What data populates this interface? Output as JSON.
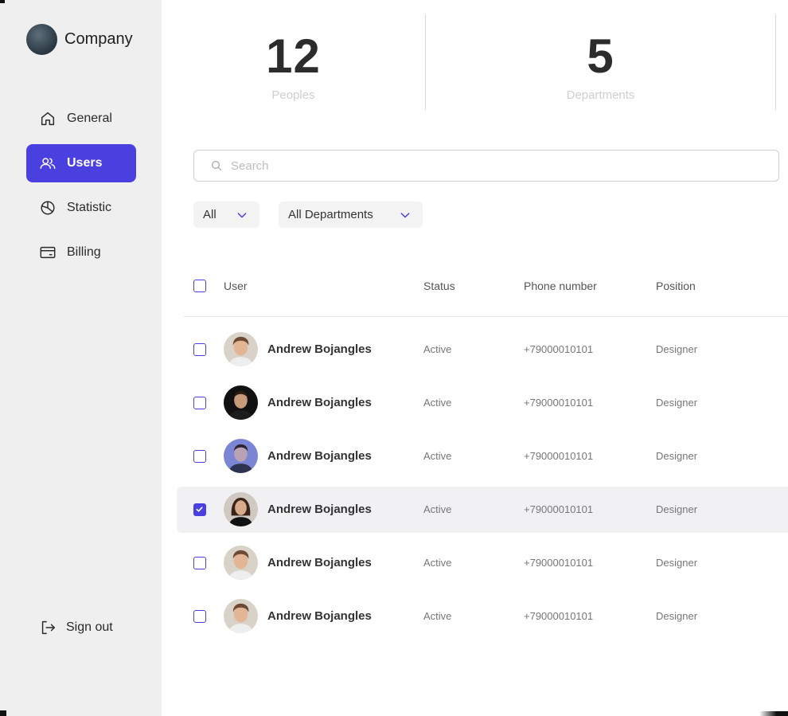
{
  "brand": {
    "name": "Company"
  },
  "nav": [
    {
      "label": "General",
      "icon": "home-icon",
      "active": false
    },
    {
      "label": "Users",
      "icon": "users-icon",
      "active": true
    },
    {
      "label": "Statistic",
      "icon": "pie-chart-icon",
      "active": false
    },
    {
      "label": "Billing",
      "icon": "credit-card-icon",
      "active": false
    }
  ],
  "signout": {
    "label": "Sign out",
    "icon": "sign-out-icon"
  },
  "stats": [
    {
      "value": "12",
      "label": "Peoples"
    },
    {
      "value": "5",
      "label": "Departments"
    }
  ],
  "search": {
    "placeholder": "Search",
    "value": ""
  },
  "filters": {
    "status": "All",
    "department": "All Departments"
  },
  "table": {
    "headers": {
      "user": "User",
      "status": "Status",
      "phone": "Phone number",
      "position": "Position"
    },
    "rows": [
      {
        "name": "Andrew Bojangles",
        "status": "Active",
        "phone": "+79000010101",
        "position": "Designer",
        "checked": false
      },
      {
        "name": "Andrew Bojangles",
        "status": "Active",
        "phone": "+79000010101",
        "position": "Designer",
        "checked": false
      },
      {
        "name": "Andrew Bojangles",
        "status": "Active",
        "phone": "+79000010101",
        "position": "Designer",
        "checked": false
      },
      {
        "name": "Andrew Bojangles",
        "status": "Active",
        "phone": "+79000010101",
        "position": "Designer",
        "checked": true
      },
      {
        "name": "Andrew Bojangles",
        "status": "Active",
        "phone": "+79000010101",
        "position": "Designer",
        "checked": false
      },
      {
        "name": "Andrew Bojangles",
        "status": "Active",
        "phone": "+79000010101",
        "position": "Designer",
        "checked": false
      }
    ]
  },
  "colors": {
    "accent": "#4a40e0",
    "sidebar": "#efefef",
    "selected_row": "#f1f1f4"
  }
}
